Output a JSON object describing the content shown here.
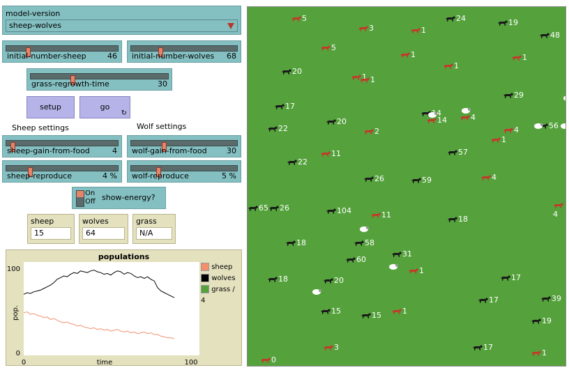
{
  "chooser": {
    "label": "model-version",
    "value": "sheep-wolves"
  },
  "sliders": {
    "initial_number_sheep": {
      "name": "initial-number-sheep",
      "value": "46",
      "level": 0.18
    },
    "initial_number_wolves": {
      "name": "initial-number-wolves",
      "value": "68",
      "level": 0.27
    },
    "grass_regrowth_time": {
      "name": "grass-regrowth-time",
      "value": "30",
      "level": 0.3
    },
    "sheep_gain_from_food": {
      "name": "sheep-gain-from-food",
      "value": "4",
      "level": 0.04
    },
    "wolf_gain_from_food": {
      "name": "wolf-gain-from-food",
      "value": "30",
      "level": 0.3
    },
    "sheep_reproduce": {
      "name": "sheep-reproduce",
      "value": "4 %",
      "level": 0.2
    },
    "wolf_reproduce": {
      "name": "wolf-reproduce",
      "value": "5 %",
      "level": 0.25
    }
  },
  "buttons": {
    "setup": "setup",
    "go": "go"
  },
  "sections": {
    "sheep": "Sheep settings",
    "wolf": "Wolf settings"
  },
  "switch": {
    "on": "On",
    "off": "Off",
    "label": "show-energy?"
  },
  "monitors": {
    "sheep": {
      "label": "sheep",
      "value": "15"
    },
    "wolves": {
      "label": "wolves",
      "value": "64"
    },
    "grass": {
      "label": "grass",
      "value": "N/A"
    }
  },
  "plot_title": "populations",
  "colors": {
    "sheep": "#f2906b",
    "wolves": "#000000",
    "grass": "#55a23d",
    "world": "#55a23d",
    "wolf_agent": "#1a1a1a",
    "sheep_agent": "#ffffff",
    "red_agent": "#c23b2a"
  },
  "chart_data": {
    "type": "line",
    "title": "populations",
    "xlabel": "time",
    "ylabel": "pop.",
    "xlim": [
      0,
      100
    ],
    "ylim": [
      0,
      100
    ],
    "x_ticks": [
      "0",
      "100"
    ],
    "y_ticks": [
      "0",
      "100"
    ],
    "legend": [
      "sheep",
      "wolves",
      "grass / 4"
    ],
    "legend_position": "right",
    "series": [
      {
        "name": "wolves",
        "x": [
          0,
          2,
          4,
          6,
          8,
          10,
          12,
          14,
          16,
          18,
          20,
          22,
          24,
          26,
          28,
          30,
          32,
          34,
          36,
          38,
          40,
          42,
          44,
          46,
          48,
          50,
          52,
          54,
          56,
          58,
          60,
          62,
          64,
          66,
          68,
          70,
          72,
          74,
          76,
          78,
          80,
          82,
          84,
          86,
          88,
          90
        ],
        "y": [
          68,
          70,
          69,
          71,
          72,
          73,
          75,
          77,
          79,
          82,
          86,
          88,
          90,
          89,
          92,
          94,
          93,
          96,
          95,
          94,
          96,
          97,
          95,
          94,
          92,
          93,
          91,
          94,
          96,
          95,
          92,
          94,
          93,
          90,
          88,
          89,
          87,
          89,
          86,
          84,
          76,
          72,
          70,
          68,
          66,
          64
        ]
      },
      {
        "name": "sheep",
        "x": [
          0,
          2,
          4,
          6,
          8,
          10,
          12,
          14,
          16,
          18,
          20,
          22,
          24,
          26,
          28,
          30,
          32,
          34,
          36,
          38,
          40,
          42,
          44,
          46,
          48,
          50,
          52,
          54,
          56,
          58,
          60,
          62,
          64,
          66,
          68,
          70,
          72,
          74,
          76,
          78,
          80,
          82,
          84,
          86,
          88,
          90
        ],
        "y": [
          46,
          47,
          44,
          45,
          43,
          42,
          40,
          41,
          38,
          39,
          37,
          35,
          34,
          35,
          33,
          32,
          30,
          31,
          29,
          28,
          27,
          28,
          26,
          27,
          25,
          26,
          24,
          25,
          26,
          24,
          23,
          24,
          22,
          23,
          21,
          22,
          23,
          21,
          22,
          20,
          20,
          18,
          17,
          16,
          16,
          15
        ]
      }
    ]
  },
  "agents": [
    {
      "label": "5",
      "kind": "red"
    },
    {
      "label": "3",
      "kind": "red"
    },
    {
      "label": "1",
      "kind": "red"
    },
    {
      "label": "24",
      "kind": "wolf"
    },
    {
      "label": "19",
      "kind": "wolf"
    },
    {
      "label": "48",
      "kind": "wolf"
    },
    {
      "label": "5",
      "kind": "red"
    },
    {
      "label": "1",
      "kind": "red"
    },
    {
      "label": "1",
      "kind": "red"
    },
    {
      "label": "1",
      "kind": "red"
    },
    {
      "label": "20",
      "kind": "wolf"
    },
    {
      "label": "1",
      "kind": "red"
    },
    {
      "label": "1",
      "kind": "red"
    },
    {
      "label": "29",
      "kind": "wolf"
    },
    {
      "label": "17",
      "kind": "wolf"
    },
    {
      "label": "14",
      "kind": "wolf"
    },
    {
      "label": "14",
      "kind": "red"
    },
    {
      "label": "4",
      "kind": "red"
    },
    {
      "label": "56",
      "kind": "wolf"
    },
    {
      "label": "22",
      "kind": "wolf"
    },
    {
      "label": "20",
      "kind": "wolf"
    },
    {
      "label": "2",
      "kind": "red"
    },
    {
      "label": "1",
      "kind": "red"
    },
    {
      "label": "4",
      "kind": "red"
    },
    {
      "label": "11",
      "kind": "red"
    },
    {
      "label": "57",
      "kind": "wolf"
    },
    {
      "label": "22",
      "kind": "wolf"
    },
    {
      "label": "26",
      "kind": "wolf"
    },
    {
      "label": "59",
      "kind": "wolf"
    },
    {
      "label": "4",
      "kind": "red"
    },
    {
      "label": "65",
      "kind": "wolf"
    },
    {
      "label": "26",
      "kind": "wolf"
    },
    {
      "label": "104",
      "kind": "wolf"
    },
    {
      "label": "11",
      "kind": "red"
    },
    {
      "label": "18",
      "kind": "wolf"
    },
    {
      "label": "4",
      "kind": "red"
    },
    {
      "label": "18",
      "kind": "wolf"
    },
    {
      "label": "58",
      "kind": "wolf"
    },
    {
      "label": "31",
      "kind": "wolf"
    },
    {
      "label": "60",
      "kind": "wolf"
    },
    {
      "label": "1",
      "kind": "red"
    },
    {
      "label": "18",
      "kind": "wolf"
    },
    {
      "label": "20",
      "kind": "wolf"
    },
    {
      "label": "17",
      "kind": "wolf"
    },
    {
      "label": "15",
      "kind": "wolf"
    },
    {
      "label": "15",
      "kind": "wolf"
    },
    {
      "label": "1",
      "kind": "red"
    },
    {
      "label": "17",
      "kind": "wolf"
    },
    {
      "label": "39",
      "kind": "wolf"
    },
    {
      "label": "19",
      "kind": "wolf"
    },
    {
      "label": "3",
      "kind": "red"
    },
    {
      "label": "17",
      "kind": "wolf"
    },
    {
      "label": "1",
      "kind": "red"
    },
    {
      "label": "0",
      "kind": "red"
    }
  ]
}
